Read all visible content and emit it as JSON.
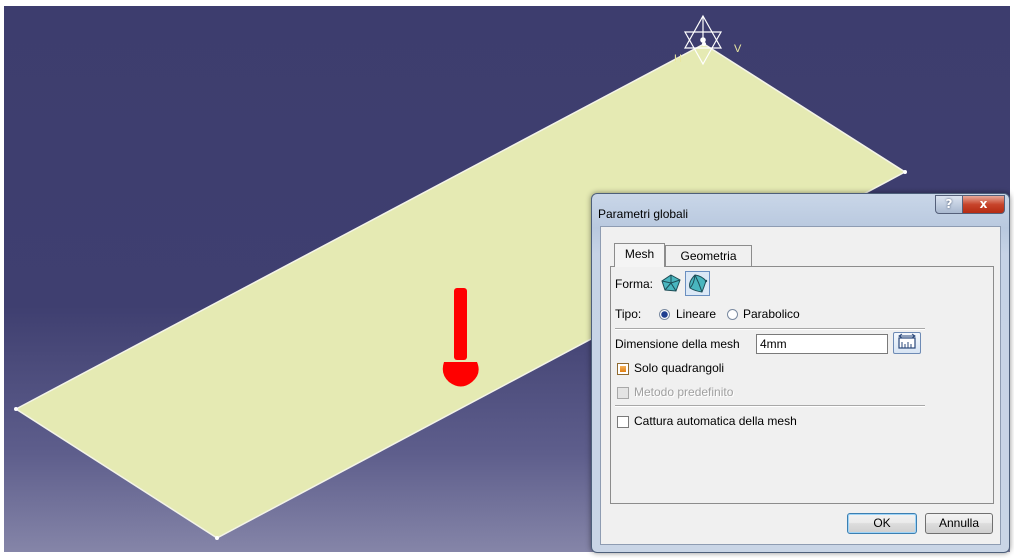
{
  "viewport": {
    "axis_labels": {
      "x": "H",
      "y": "V"
    },
    "colors": {
      "background_top": "#3d3d6e",
      "background_bottom": "#8585a8",
      "surface": "#e5eab3",
      "load_arrow": "#ff0000"
    }
  },
  "dialog": {
    "title": "Parametri globali",
    "help_glyph": "?",
    "close_glyph": "x",
    "tabs": [
      {
        "label": "Mesh",
        "selected": true
      },
      {
        "label": "Geometria",
        "selected": false
      }
    ],
    "forma_label": "Forma:",
    "forma_options": [
      {
        "icon": "linear-element-icon",
        "selected": false
      },
      {
        "icon": "parabolic-element-icon",
        "selected": true
      }
    ],
    "tipo_label": "Tipo:",
    "tipo_options": [
      {
        "label": "Lineare",
        "selected": true
      },
      {
        "label": "Parabolico",
        "selected": false
      }
    ],
    "mesh_size_label": "Dimensione della mesh",
    "mesh_size_value": "4mm",
    "measure_icon": "measure-icon",
    "solo_quadrangoli": {
      "label": "Solo quadrangoli",
      "checked": true,
      "enabled": true
    },
    "metodo_predefinito": {
      "label": "Metodo predefinito",
      "checked": false,
      "enabled": false
    },
    "cattura_automatica": {
      "label": "Cattura automatica della mesh",
      "checked": false,
      "enabled": true
    },
    "ok_label": "OK",
    "cancel_label": "Annulla"
  }
}
